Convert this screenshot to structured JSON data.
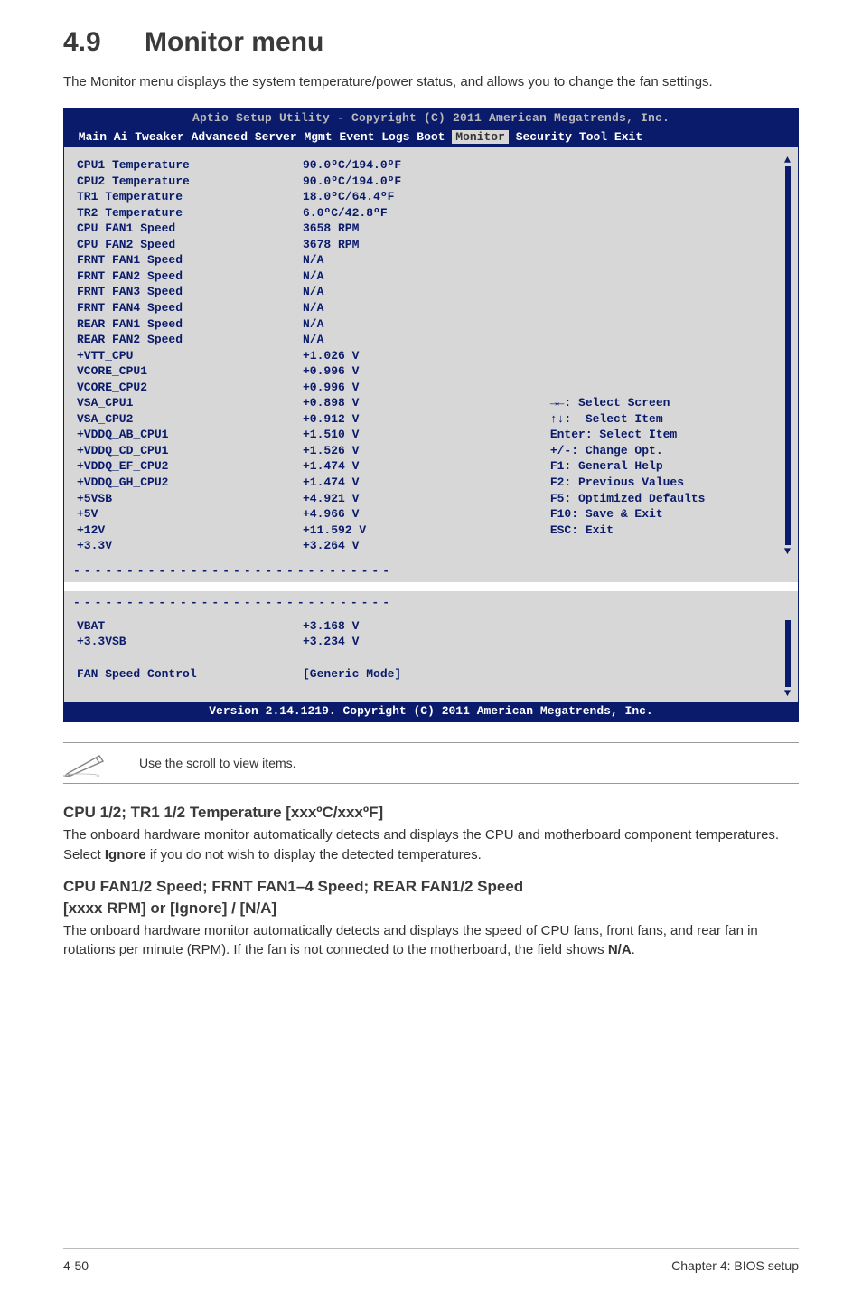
{
  "page": {
    "section_number": "4.9",
    "section_title": "Monitor menu",
    "intro": "The Monitor menu displays the system temperature/power status, and allows you to change the fan settings.",
    "note": "Use the scroll to view items.",
    "sub1_heading": "CPU 1/2; TR1 1/2 Temperature [xxxºC/xxxºF]",
    "sub1_body": "The onboard hardware monitor automatically detects and displays the CPU and motherboard component temperatures. Select Ignore if you do not wish to display the detected temperatures.",
    "sub1_bold_word": "Ignore",
    "sub2_heading_l1": "CPU FAN1/2 Speed; FRNT FAN1–4 Speed; REAR FAN1/2 Speed",
    "sub2_heading_l2": "[xxxx RPM] or [Ignore] / [N/A]",
    "sub2_body": "The onboard hardware monitor automatically detects and displays the speed of CPU fans, front fans, and rear fan in rotations per minute (RPM). If the fan is not connected to the motherboard, the field shows N/A.",
    "sub2_bold_word": "N/A",
    "footer_left": "4-50",
    "footer_right": "Chapter 4: BIOS setup"
  },
  "bios": {
    "title": "Aptio Setup Utility - Copyright (C) 2011 American Megatrends, Inc.",
    "menubar_before": " Main Ai Tweaker Advanced Server Mgmt Event Logs Boot ",
    "menubar_active": "Monitor",
    "menubar_after": " Security Tool Exit",
    "rows": [
      {
        "label": "CPU1 Temperature",
        "value": "90.0ºC/194.0ºF"
      },
      {
        "label": "CPU2 Temperature",
        "value": "90.0ºC/194.0ºF"
      },
      {
        "label": "TR1 Temperature",
        "value": "18.0ºC/64.4ºF"
      },
      {
        "label": "TR2 Temperature",
        "value": "6.0ºC/42.8ºF"
      },
      {
        "label": "CPU FAN1 Speed",
        "value": "3658 RPM"
      },
      {
        "label": "CPU FAN2 Speed",
        "value": "3678 RPM"
      },
      {
        "label": "FRNT FAN1 Speed",
        "value": "N/A"
      },
      {
        "label": "FRNT FAN2 Speed",
        "value": "N/A"
      },
      {
        "label": "FRNT FAN3 Speed",
        "value": "N/A"
      },
      {
        "label": "FRNT FAN4 Speed",
        "value": "N/A"
      },
      {
        "label": "REAR FAN1 Speed",
        "value": "N/A"
      },
      {
        "label": "REAR FAN2 Speed",
        "value": "N/A"
      },
      {
        "label": "+VTT_CPU",
        "value": "+1.026 V"
      },
      {
        "label": "VCORE_CPU1",
        "value": "+0.996 V"
      },
      {
        "label": "VCORE_CPU2",
        "value": "+0.996 V"
      },
      {
        "label": "VSA_CPU1",
        "value": "+0.898 V"
      },
      {
        "label": "VSA_CPU2",
        "value": "+0.912 V"
      },
      {
        "label": "+VDDQ_AB_CPU1",
        "value": "+1.510 V"
      },
      {
        "label": "+VDDQ_CD_CPU1",
        "value": "+1.526 V"
      },
      {
        "label": "+VDDQ_EF_CPU2",
        "value": "+1.474 V"
      },
      {
        "label": "+VDDQ_GH_CPU2",
        "value": "+1.474 V"
      },
      {
        "label": "+5VSB",
        "value": "+4.921 V"
      },
      {
        "label": "+5V",
        "value": "+4.966 V"
      },
      {
        "label": "+12V",
        "value": "+11.592 V"
      },
      {
        "label": "+3.3V",
        "value": "+3.264 V"
      }
    ],
    "help": [
      "→←: Select Screen",
      "↑↓:  Select Item",
      "Enter: Select Item",
      "+/-: Change Opt.",
      "F1: General Help",
      "F2: Previous Values",
      "F5: Optimized Defaults",
      "F10: Save & Exit",
      "ESC: Exit"
    ],
    "box2_rows": [
      {
        "label": "VBAT",
        "value": "+3.168 V"
      },
      {
        "label": "+3.3VSB",
        "value": "+3.234 V"
      }
    ],
    "box2_extra": {
      "label": "FAN Speed Control",
      "value": "[Generic Mode]"
    },
    "footer": "Version 2.14.1219. Copyright (C) 2011 American Megatrends, Inc."
  }
}
